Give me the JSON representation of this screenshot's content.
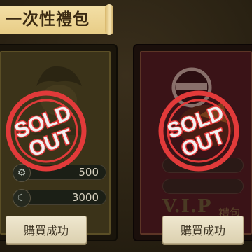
{
  "title": "一次性禮包",
  "cards": [
    {
      "rewards": [
        "500",
        "3000"
      ],
      "status": "SOLD OUT",
      "button_label": "購買成功"
    },
    {
      "vip_label": "V.I.P",
      "pack_label": "禮包",
      "status": "SOLD OUT",
      "button_label": "購買成功"
    }
  ],
  "colors": {
    "banner": "#e8cd87",
    "stamp_red": "#e23a3a",
    "left_card": "#3b3319",
    "right_card": "#3a1317"
  }
}
